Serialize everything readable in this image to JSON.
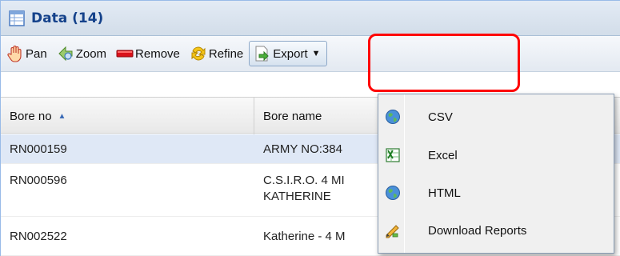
{
  "panel": {
    "title": "Data (14)"
  },
  "toolbar": {
    "pan_label": "Pan",
    "zoom_label": "Zoom",
    "remove_label": "Remove",
    "refine_label": "Refine",
    "export_label": "Export"
  },
  "grid": {
    "columns": [
      "Bore no",
      "Bore name"
    ],
    "rows": [
      {
        "bore_no": "RN000159",
        "bore_name": "ARMY NO:384"
      },
      {
        "bore_no": "RN000596",
        "bore_name_line1": "C.S.I.R.O. 4 MI",
        "bore_name_line2": "KATHERINE"
      },
      {
        "bore_no": "RN002522",
        "bore_name": "Katherine - 4 M"
      }
    ]
  },
  "export_menu": {
    "items": [
      {
        "label": "CSV",
        "icon": "globe-icon"
      },
      {
        "label": "Excel",
        "icon": "excel-icon"
      },
      {
        "label": "HTML",
        "icon": "globe-icon"
      },
      {
        "label": "Download Reports",
        "icon": "pencil-report-icon"
      }
    ]
  },
  "colors": {
    "highlight": "#ff0000",
    "header_text": "#15428b",
    "selected_row": "#dfe8f6"
  }
}
